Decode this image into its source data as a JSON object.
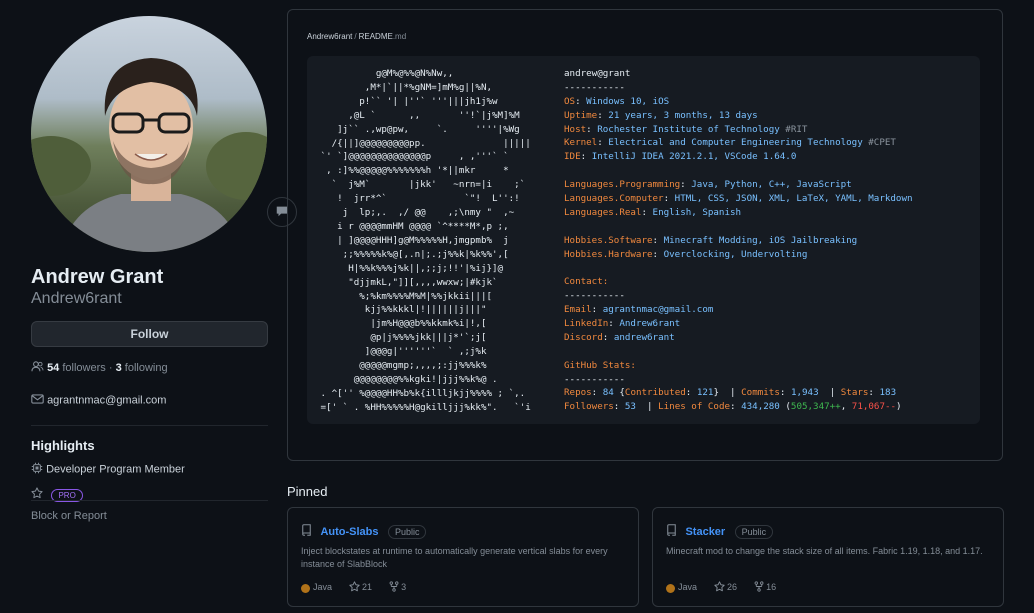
{
  "profile": {
    "name": "Andrew Grant",
    "login": "Andrew6rant",
    "follow_label": "Follow",
    "followers_count": "54",
    "followers_label": "followers",
    "following_count": "3",
    "following_label": "following",
    "email": "agrantnmac@gmail.com"
  },
  "highlights": {
    "title": "Highlights",
    "developer_program": "Developer Program Member",
    "pro_badge": "PRO",
    "block_report": "Block or Report"
  },
  "readme": {
    "owner": "Andrew6rant",
    "separator": "/",
    "file": "README",
    "ext": ".md",
    "ascii_art": "           g@M%@%%@N%Nw,,\n         ,M*|`||*%gNM=]mM%g||%N,\n        p!`` '| |''` '''|||jh1j%w\n      ,@L `      ,,       ''!`|j%M]%M\n    ]j`` .,wp@pw,     `.     ''''|%Wg\n   /{||]@@@@@@@@@pp.              |||||\n `' `]@@@@@@@@@@@@@@p     , ,'''` `\n  , :]%%@@@@@%%%%%%%h '*||mkr     *\n   `  j%M`       |jkk'   ~nrn=|i    ;`\n    !  jrr*^`              `\"!  L'':!\n     j  lp;,.  ,/ @@    ,;\\nmy \"  ,~\n    i r @@@@mmHM @@@@ `^****M*,p ;,\n    | ]@@@@HHH]g@M%%%%%H,jmgpmb%  j\n     ;;%%%%%k%@[,.n|;.;j%%k|%k%%',[\n      H|%%k%%%j%k||,;;j;!!'|%ij}]@\n      \"djjmkL,\"]][,,,,wwxw;|#kjk`\n        %;%km%%%%M%M|%%jkkii|||[\n         kjj%%kkkl|!||||||j|||\"\n          |jm%H@@@b%%kkmk%i|!,[\n          @p|j%%%%jkk|||j*'`;j[\n         ]@@@g|''''''`  ` ,;j%k\n        @@@@@mgmp;,,,,;:jj%%%k%\n       @@@@@@@@%%kgki!|jjj%%k%@ .\n . ^['' %@@@@HH%b%k{illljkjj%%%% ; `,.\n =[' ` . %HH%%%%%H@gkilljjj%kk%\".   `'i",
    "lines": [
      [
        "andrew@grant"
      ],
      [
        "-----------"
      ],
      [
        "OS",
        ": ",
        "Windows 10, iOS"
      ],
      [
        "Uptime",
        ": ",
        "21 years, 3 months, 13 days"
      ],
      [
        "Host",
        ": ",
        "Rochester Institute of Technology",
        " #RIT"
      ],
      [
        "Kernel",
        ": ",
        "Electrical and Computer Engineering Technology",
        " #CPET"
      ],
      [
        "IDE",
        ": ",
        "IntelliJ IDEA 2021.2.1, VSCode 1.64.0"
      ],
      [
        ""
      ],
      [
        "Languages.Programming",
        ": ",
        "Java, Python, C++, JavaScript"
      ],
      [
        "Languages.Computer",
        ": ",
        "HTML, CSS, JSON, XML, LaTeX, YAML, Markdown"
      ],
      [
        "Languages.Real",
        ": ",
        "English, Spanish"
      ],
      [
        ""
      ],
      [
        "Hobbies.Software",
        ": ",
        "Minecraft Modding, iOS Jailbreaking"
      ],
      [
        "Hobbies.Hardware",
        ": ",
        "Overclocking, Undervolting"
      ],
      [
        ""
      ],
      [
        "Contact:"
      ],
      [
        "-----------"
      ],
      [
        "Email",
        ": ",
        "agrantnmac@gmail.com"
      ],
      [
        "LinkedIn",
        ": ",
        "Andrew6rant"
      ],
      [
        "Discord",
        ": ",
        "andrew6rant"
      ],
      [
        ""
      ],
      [
        "GitHub Stats:"
      ],
      [
        "-----------"
      ]
    ],
    "stats_repos_label": "Repos",
    "stats_repos": "84",
    "stats_contributed_label": "Contributed",
    "stats_contributed": "121",
    "stats_commits_label": "Commits",
    "stats_commits": "1,943",
    "stats_stars_label": "Stars",
    "stats_stars": "183",
    "stats_followers_label": "Followers",
    "stats_followers": "53",
    "stats_loc_label": "Lines of Code",
    "stats_loc": "434,280",
    "stats_added": "505,347++",
    "stats_removed": "71,067--"
  },
  "pinned": {
    "title": "Pinned",
    "repos": [
      {
        "name": "Auto-Slabs",
        "visibility": "Public",
        "description": "Inject blockstates at runtime to automatically generate vertical slabs for every instance of SlabBlock",
        "language": "Java",
        "language_color": "#b07219",
        "stars": "21",
        "forks": "3"
      },
      {
        "name": "Stacker",
        "visibility": "Public",
        "description": "Minecraft mod to change the stack size of all items. Fabric 1.19, 1.18, and 1.17.",
        "language": "Java",
        "language_color": "#b07219",
        "stars": "26",
        "forks": "16"
      }
    ]
  }
}
